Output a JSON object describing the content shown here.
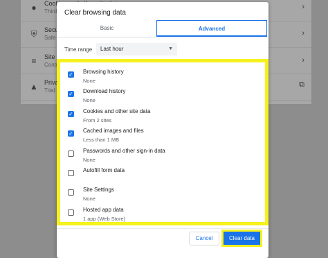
{
  "background": {
    "rows": [
      {
        "icon": "cookie-icon",
        "title": "Cookies and other site data",
        "sub": "Third",
        "right": "›"
      },
      {
        "icon": "shield-icon",
        "title": "Secu",
        "sub": "Safe",
        "right": "›"
      },
      {
        "icon": "sliders-icon",
        "title": "Site S",
        "sub": "Contr",
        "right": "›"
      },
      {
        "icon": "flask-icon",
        "title": "Priva",
        "sub": "Trial",
        "right": "⧉"
      }
    ]
  },
  "dialog": {
    "title": "Clear browsing data",
    "tabs": {
      "basic": "Basic",
      "advanced": "Advanced"
    },
    "time_range_label": "Time range",
    "time_range_value": "Last hour",
    "options": [
      {
        "title": "Browsing history",
        "desc": "None",
        "checked": true
      },
      {
        "title": "Download history",
        "desc": "None",
        "checked": true
      },
      {
        "title": "Cookies and other site data",
        "desc": "From 2 sites",
        "checked": true
      },
      {
        "title": "Cached images and files",
        "desc": "Less than 1 MB",
        "checked": true
      },
      {
        "title": "Passwords and other sign-in data",
        "desc": "None",
        "checked": false
      },
      {
        "title": "Autofill form data",
        "desc": "",
        "checked": false
      },
      {
        "title": "Site Settings",
        "desc": "None",
        "checked": false
      },
      {
        "title": "Hosted app data",
        "desc": "1 app (Web Store)",
        "checked": false
      }
    ],
    "cancel_label": "Cancel",
    "clear_label": "Clear data"
  },
  "colors": {
    "accent": "#1a73e8",
    "highlight": "#f7f11e"
  }
}
